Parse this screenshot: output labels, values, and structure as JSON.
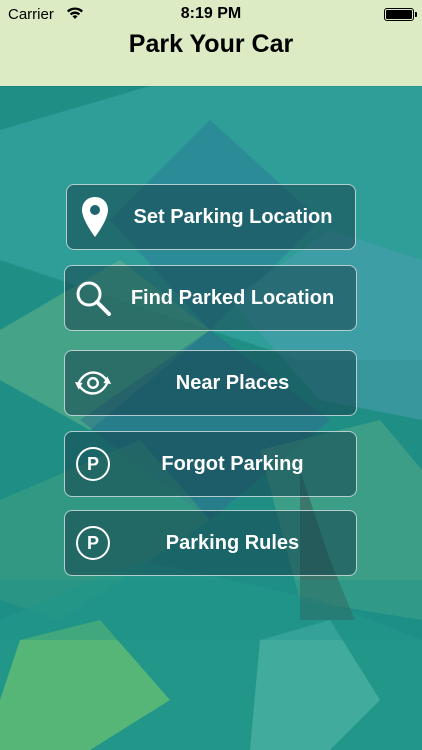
{
  "status_bar": {
    "carrier": "Carrier",
    "time": "8:19 PM"
  },
  "nav": {
    "title": "Park Your Car"
  },
  "menu": {
    "items": [
      {
        "label": "Set Parking Location",
        "icon": "location-pin-icon"
      },
      {
        "label": "Find Parked Location",
        "icon": "magnifier-icon"
      },
      {
        "label": "Near Places",
        "icon": "eye-refresh-icon"
      },
      {
        "label": "Forgot Parking",
        "icon": "parking-p-icon",
        "glyph": "P"
      },
      {
        "label": "Parking Rules",
        "icon": "parking-p-icon",
        "glyph": "P"
      }
    ]
  },
  "colors": {
    "topbar": "#dcebc4",
    "background": "#1f8f86",
    "button_fill": "rgba(22,68,78,0.55)"
  }
}
